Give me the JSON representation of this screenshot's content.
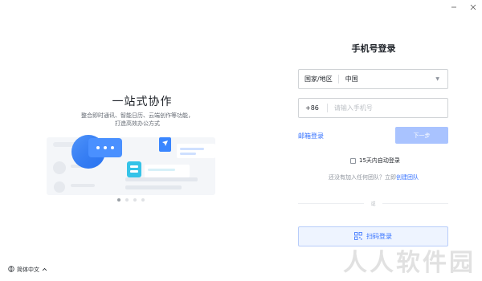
{
  "window": {
    "minimize_icon": "minimize-icon",
    "close_icon": "close-icon"
  },
  "left": {
    "title": "一站式协作",
    "desc_line1": "整合即时通讯、智能日历、云端创作等功能，",
    "desc_line2": "打造高效办公方式",
    "carousel": {
      "count": 4,
      "active": 1
    },
    "language": "简体中文"
  },
  "login": {
    "title": "手机号登录",
    "country_label": "国家/地区",
    "country_value": "中国",
    "phone_prefix": "+86",
    "phone_placeholder": "请输入手机号",
    "email_link": "邮箱登录",
    "next_button": "下一步",
    "auto_login": "15天内自动登录",
    "team_prompt": "还没有加入任何团队？立即",
    "create_team": "创建团队",
    "or": "或",
    "qr_button": "扫码登录"
  },
  "watermark": "人人软件园",
  "colors": {
    "accent": "#3370ff",
    "next_disabled": "#a9c3ff",
    "qr_bg": "#eef4ff"
  }
}
